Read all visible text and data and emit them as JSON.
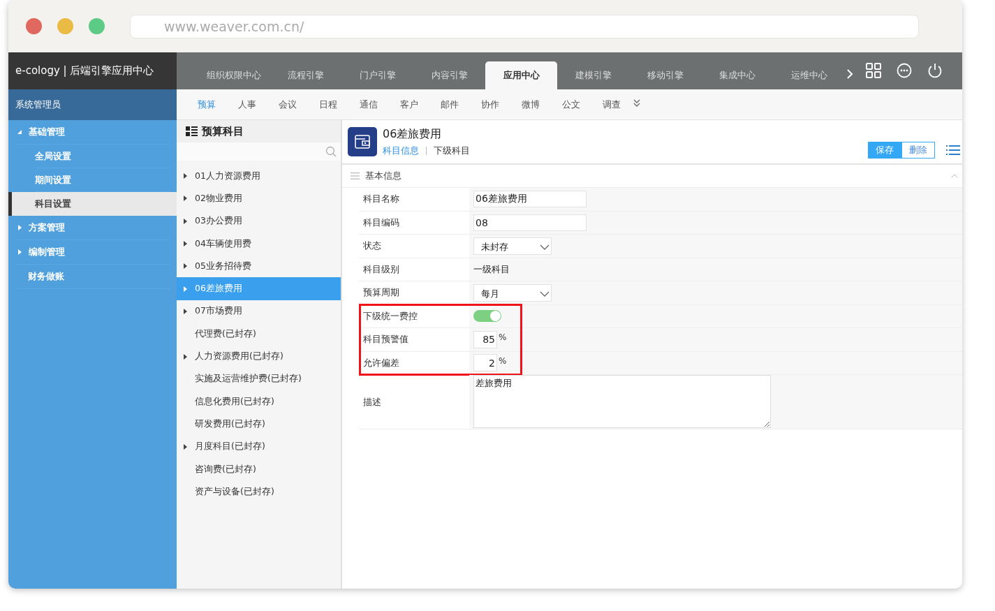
{
  "browser": {
    "url": "www.weaver.com.cn/"
  },
  "header": {
    "logo": "e-cology | 后端引擎应用中心",
    "tabs": [
      {
        "label": "组织权限中心",
        "selected": false
      },
      {
        "label": "流程引擎",
        "selected": false
      },
      {
        "label": "门户引擎",
        "selected": false
      },
      {
        "label": "内容引擎",
        "selected": false
      },
      {
        "label": "应用中心",
        "selected": true
      },
      {
        "label": "建模引擎",
        "selected": false
      },
      {
        "label": "移动引擎",
        "selected": false
      },
      {
        "label": "集成中心",
        "selected": false
      },
      {
        "label": "运维中心",
        "selected": false
      }
    ]
  },
  "subnav": [
    {
      "label": "预算",
      "selected": true
    },
    {
      "label": "人事",
      "selected": false
    },
    {
      "label": "会议",
      "selected": false
    },
    {
      "label": "日程",
      "selected": false
    },
    {
      "label": "通信",
      "selected": false
    },
    {
      "label": "客户",
      "selected": false
    },
    {
      "label": "邮件",
      "selected": false
    },
    {
      "label": "协作",
      "selected": false
    },
    {
      "label": "微博",
      "selected": false
    },
    {
      "label": "公文",
      "selected": false
    },
    {
      "label": "调查",
      "selected": false
    }
  ],
  "sidebar": {
    "user": "系统管理员",
    "items": [
      {
        "label": "基础管理",
        "kind": "group",
        "expanded": true,
        "children": [
          {
            "label": "全局设置",
            "selected": false
          },
          {
            "label": "期间设置",
            "selected": false
          },
          {
            "label": "科目设置",
            "selected": true
          }
        ]
      },
      {
        "label": "方案管理",
        "kind": "group",
        "expanded": false
      },
      {
        "label": "编制管理",
        "kind": "group",
        "expanded": false
      },
      {
        "label": "财务做账",
        "kind": "leaf"
      }
    ]
  },
  "tree": {
    "title": "预算科目",
    "items": [
      {
        "label": "01人力资源费用",
        "has_children": true,
        "selected": false
      },
      {
        "label": "02物业费用",
        "has_children": true,
        "selected": false
      },
      {
        "label": "03办公费用",
        "has_children": true,
        "selected": false
      },
      {
        "label": "04车辆使用费",
        "has_children": true,
        "selected": false
      },
      {
        "label": "05业务招待费",
        "has_children": true,
        "selected": false
      },
      {
        "label": "06差旅费用",
        "has_children": true,
        "selected": true
      },
      {
        "label": "07市场费用",
        "has_children": true,
        "selected": false
      },
      {
        "label": "代理费(已封存)",
        "has_children": false,
        "selected": false
      },
      {
        "label": "人力资源费用(已封存)",
        "has_children": true,
        "selected": false
      },
      {
        "label": "实施及运营维护费(已封存)",
        "has_children": false,
        "selected": false
      },
      {
        "label": "信息化费用(已封存)",
        "has_children": false,
        "selected": false
      },
      {
        "label": "研发费用(已封存)",
        "has_children": false,
        "selected": false
      },
      {
        "label": "月度科目(已封存)",
        "has_children": true,
        "selected": false
      },
      {
        "label": "咨询费(已封存)",
        "has_children": false,
        "selected": false
      },
      {
        "label": "资产与设备(已封存)",
        "has_children": false,
        "selected": false
      }
    ]
  },
  "detail": {
    "title": "06差旅费用",
    "tabs": [
      {
        "label": "科目信息",
        "selected": true
      },
      {
        "label": "下级科目",
        "selected": false
      }
    ],
    "buttons": {
      "save": "保存",
      "delete": "删除"
    },
    "section": "基本信息",
    "fields": [
      {
        "label": "科目名称",
        "kind": "text",
        "value": "06差旅费用",
        "highlighted": false
      },
      {
        "label": "科目编码",
        "kind": "text",
        "value": "08",
        "highlighted": false
      },
      {
        "label": "状态",
        "kind": "select",
        "value": "未封存",
        "highlighted": false
      },
      {
        "label": "科目级别",
        "kind": "static",
        "value": "一级科目",
        "highlighted": false
      },
      {
        "label": "预算周期",
        "kind": "select",
        "value": "每月",
        "highlighted": false
      },
      {
        "label": "下级统一费控",
        "kind": "toggle",
        "on": true,
        "highlighted": true
      },
      {
        "label": "科目预警值",
        "kind": "percent",
        "value": "85",
        "unit": "%",
        "highlighted": true
      },
      {
        "label": "允许偏差",
        "kind": "percent",
        "value": "2",
        "unit": "%",
        "highlighted": true
      },
      {
        "label": "描述",
        "kind": "textarea",
        "value": "差旅费用",
        "highlighted": false
      }
    ]
  }
}
